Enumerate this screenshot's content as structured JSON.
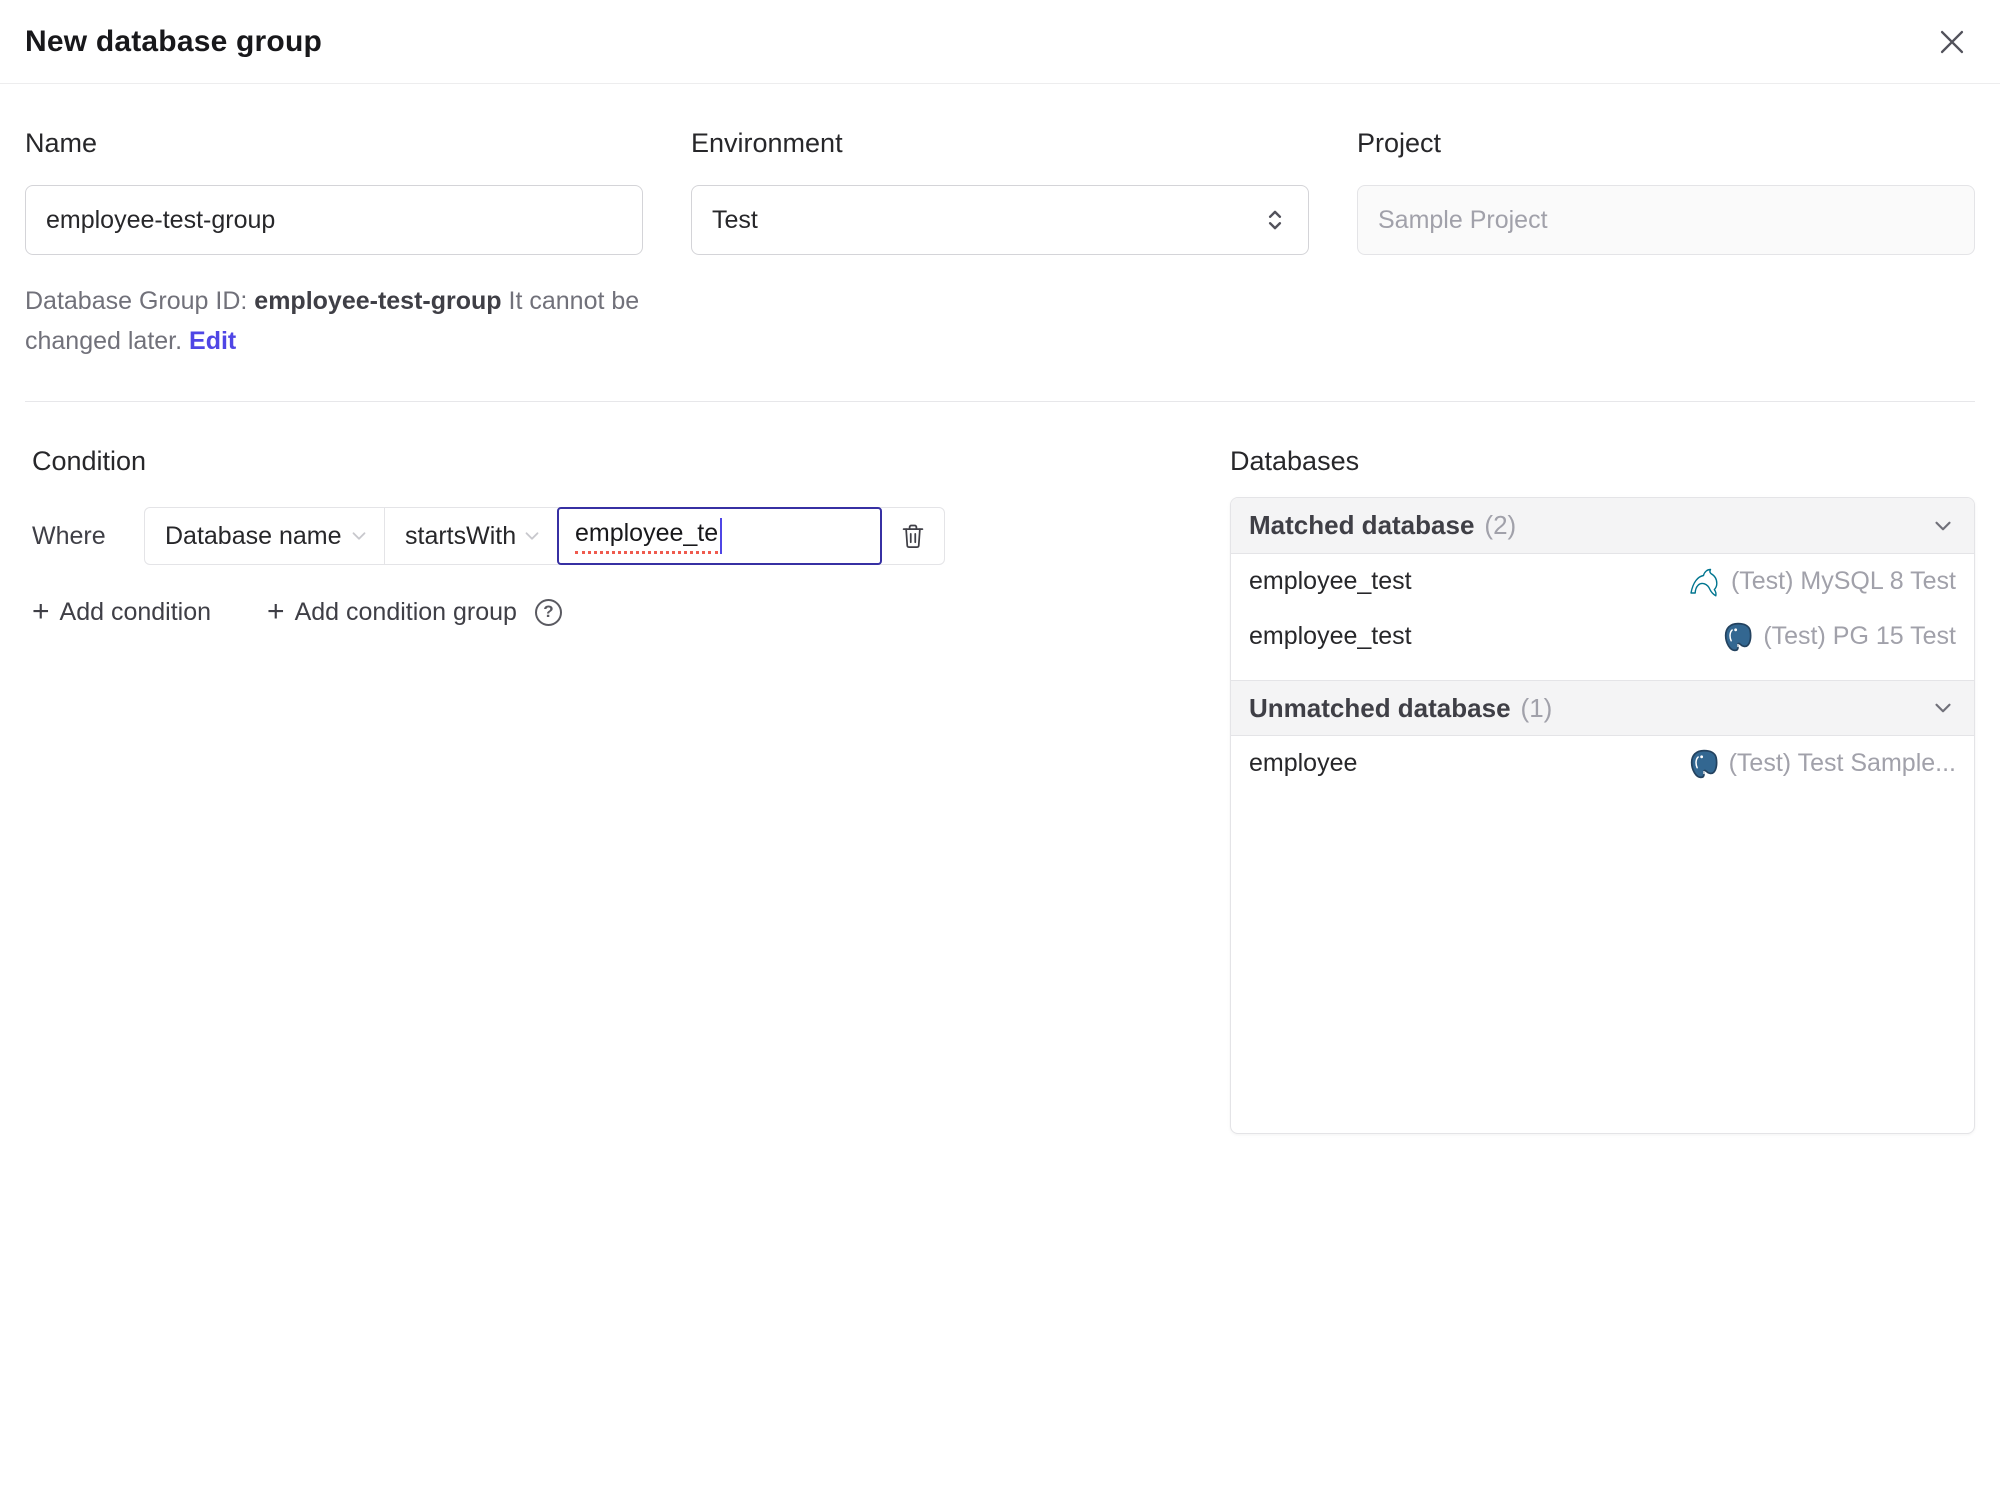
{
  "dialog": {
    "title": "New database group"
  },
  "form": {
    "name": {
      "label": "Name",
      "value": "employee-test-group"
    },
    "environment": {
      "label": "Environment",
      "value": "Test"
    },
    "project": {
      "label": "Project",
      "value": "Sample Project"
    },
    "id_note": {
      "prefix": "Database Group ID:",
      "id": "employee-test-group",
      "suffix": "It cannot be changed later.",
      "edit_label": "Edit"
    }
  },
  "condition": {
    "heading": "Condition",
    "where_label": "Where",
    "field_selected": "Database name",
    "operator_selected": "startsWith",
    "value": "employee_te",
    "plus_glyph": "+",
    "add_condition_label": "Add condition",
    "add_condition_group_label": "Add condition group",
    "help_glyph": "?"
  },
  "databases": {
    "heading": "Databases",
    "matched": {
      "label": "Matched database",
      "count": "(2)",
      "rows": [
        {
          "name": "employee_test",
          "instance": "(Test) MySQL 8 Test",
          "engine": "mysql-icon"
        },
        {
          "name": "employee_test",
          "instance": "(Test) PG 15 Test",
          "engine": "postgres-icon"
        }
      ]
    },
    "unmatched": {
      "label": "Unmatched database",
      "count": "(1)",
      "rows": [
        {
          "name": "employee",
          "instance": "(Test) Test Sample...",
          "engine": "postgres-icon"
        }
      ]
    }
  },
  "colors": {
    "accent_indigo": "#4f46e5",
    "focus_border": "#3730a3",
    "spellcheck_red": "#ef5a4e",
    "section_header_bg": "#f4f4f5",
    "muted_text": "#a1a1aa",
    "mysql_teal": "#00758f",
    "postgres_blue": "#336791"
  }
}
